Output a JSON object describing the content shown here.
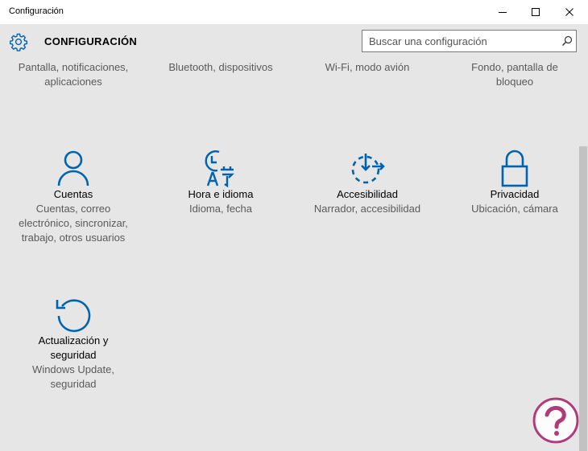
{
  "window": {
    "title": "Configuración"
  },
  "header": {
    "title": "CONFIGURACIÓN",
    "search_placeholder": "Buscar una configuración"
  },
  "top_row": [
    {
      "desc": "Pantalla, notificaciones, aplicaciones"
    },
    {
      "desc": "Bluetooth, dispositivos"
    },
    {
      "desc": "Wi-Fi, modo avión"
    },
    {
      "desc": "Fondo, pantalla de bloqueo"
    }
  ],
  "tiles": [
    {
      "name": "Cuentas",
      "desc": "Cuentas, correo electrónico, sincronizar, trabajo, otros usuarios",
      "icon": "person-icon"
    },
    {
      "name": "Hora e idioma",
      "desc": "Idioma, fecha",
      "icon": "time-language-icon"
    },
    {
      "name": "Accesibilidad",
      "desc": "Narrador, accesibilidad",
      "icon": "accessibility-icon"
    },
    {
      "name": "Privacidad",
      "desc": "Ubicación, cámara",
      "icon": "lock-icon"
    },
    {
      "name": "Actualización y seguridad",
      "desc": "Windows Update, seguridad",
      "icon": "update-icon"
    }
  ],
  "colors": {
    "accent": "#0063b1",
    "background": "#e6e6e6",
    "secondary_text": "#5a5a5a"
  }
}
